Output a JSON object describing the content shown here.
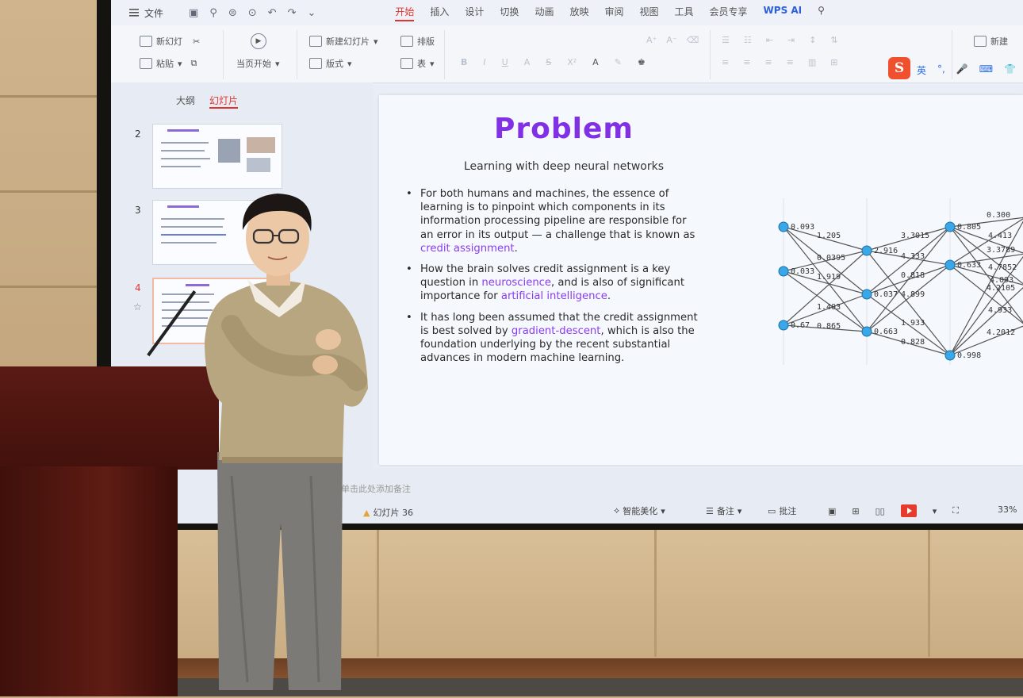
{
  "app": {
    "file_menu": "文件",
    "tabs": [
      {
        "label": "开始",
        "active": true
      },
      {
        "label": "插入"
      },
      {
        "label": "设计"
      },
      {
        "label": "切换"
      },
      {
        "label": "动画"
      },
      {
        "label": "放映"
      },
      {
        "label": "审阅"
      },
      {
        "label": "视图"
      },
      {
        "label": "工具"
      },
      {
        "label": "会员专享"
      }
    ],
    "ai_label": "WPS AI"
  },
  "ribbon": {
    "new_slide": "新幻灯",
    "layout": "版式",
    "paste": "粘贴",
    "play_from_start": "当页开始",
    "new_slide_menu": "新建幻灯片",
    "layout_menu": "版式",
    "section": "排版",
    "table": "表",
    "new_right": "新建"
  },
  "panel": {
    "tab_outline": "大纲",
    "tab_slides": "幻灯片",
    "thumbnails": [
      {
        "number": "2"
      },
      {
        "number": "3"
      },
      {
        "number": "4",
        "selected": true
      }
    ]
  },
  "slide": {
    "title": "Problem",
    "subtitle": "Learning with deep neural networks",
    "bullets": [
      {
        "parts": [
          {
            "text": "For both humans and machines, the essence of learning is to pinpoint which components in its information processing pipeline are responsible for an error in its output — a challenge that is known as "
          },
          {
            "text": "credit assignment",
            "highlight": true
          },
          {
            "text": "."
          }
        ]
      },
      {
        "parts": [
          {
            "text": "How the brain solves credit assignment is a key question in "
          },
          {
            "text": "neuroscience",
            "highlight": true
          },
          {
            "text": ", and is also of significant importance for "
          },
          {
            "text": "artificial intelligence",
            "highlight": true
          },
          {
            "text": "."
          }
        ]
      },
      {
        "parts": [
          {
            "text": "It has long been assumed that the credit assignment is best solved by "
          },
          {
            "text": "gradient-descent",
            "highlight": true
          },
          {
            "text": ", which is also the foundation underlying by the recent substantial advances in modern machine learning."
          }
        ]
      }
    ],
    "network_labels": {
      "input": [
        "0.093",
        "0.033",
        "0.67"
      ],
      "hidden1": [
        "2.916",
        "0.037",
        "0.663"
      ],
      "hidden2": [
        "0.805",
        "0.633",
        "0.998"
      ],
      "edges": [
        "1.205",
        "0.0395",
        "1.919",
        "1.403",
        "0.865",
        "3.3015",
        "4.333",
        "0.818",
        "4.899",
        "1.933",
        "0.828"
      ],
      "output": [
        "0.300",
        "4.413",
        "3.3789",
        "4.7852",
        "4.093",
        "4.2105",
        "4.933",
        "4.2012"
      ]
    },
    "highlight_color": "#8a3cf0",
    "title_color": "#8230e6"
  },
  "statusbar": {
    "notes": "单击此处添加备注",
    "slide_count": "幻灯片 36",
    "beautify": "智能美化",
    "comment": "备注",
    "annotate": "批注",
    "zoom": "33%"
  },
  "colors": {
    "accent": "#e0342c",
    "podium": "#4d140e"
  }
}
